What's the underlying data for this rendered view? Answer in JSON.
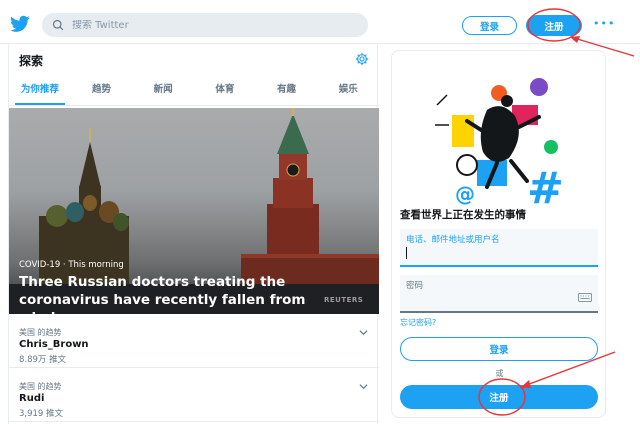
{
  "header": {
    "search_placeholder": "搜索 Twitter",
    "login_label": "登录",
    "signup_label": "注册",
    "more": "•••"
  },
  "explore": {
    "title": "探索",
    "tabs": [
      "为你推荐",
      "趋势",
      "新闻",
      "体育",
      "有趣",
      "娱乐"
    ],
    "active_tab": 0
  },
  "hero": {
    "meta": "COVID-19 · This morning",
    "title": "Three Russian doctors treating the coronavirus have recently fallen from windows",
    "credit": "REUTERS"
  },
  "trends": [
    {
      "context": "美国 的趋势",
      "name": "Chris_Brown",
      "count": "8.89万 推文"
    },
    {
      "context": "美国 的趋势",
      "name": "Rudi",
      "count": "3,919 推文"
    }
  ],
  "signup_panel": {
    "promo": "查看世界上正在发生的事情",
    "username_label": "电话、邮件地址或用户名",
    "password_label": "密码",
    "forgot": "忘记密码?",
    "login_label": "登录",
    "or": "或",
    "signup_label": "注册"
  },
  "colors": {
    "accent": "#1da1f2",
    "annotation": "#e8343a"
  }
}
